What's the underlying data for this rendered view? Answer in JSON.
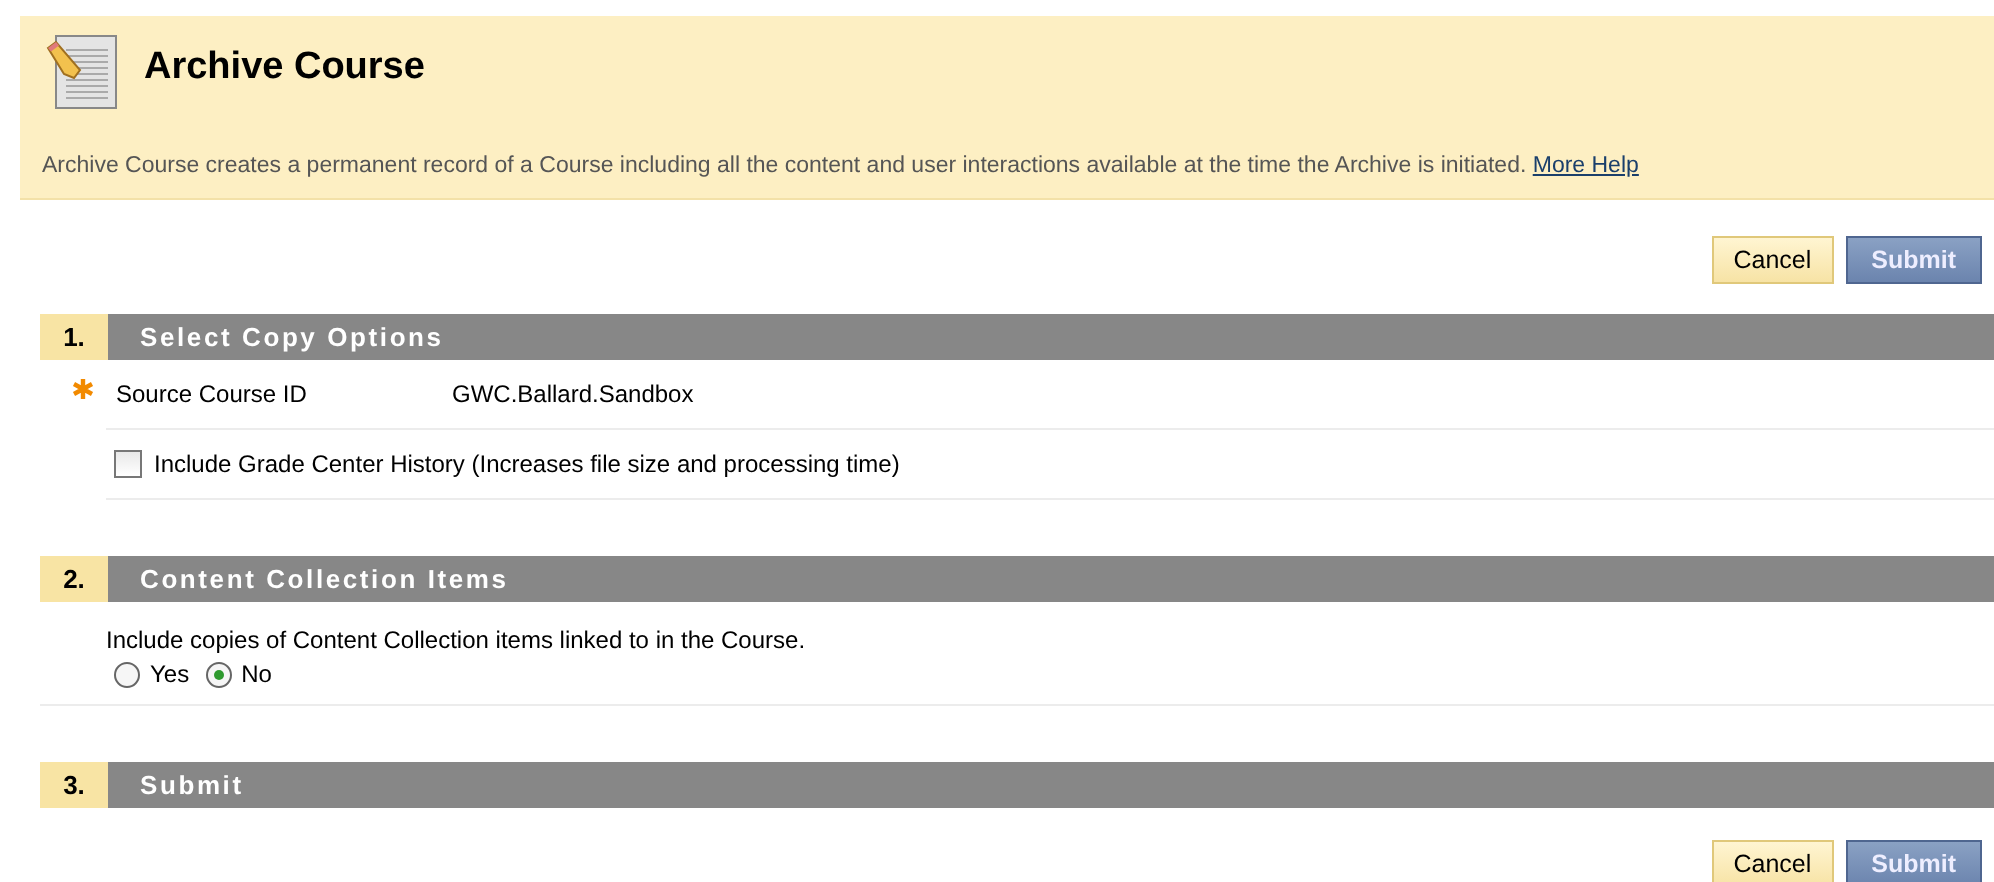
{
  "header": {
    "title": "Archive Course",
    "description": "Archive Course creates a permanent record of a Course including all the content and user interactions available at the time the Archive is initiated.",
    "help_link": "More Help"
  },
  "top_buttons": [
    {
      "label": "Cancel",
      "kind": "secondary"
    },
    {
      "label": "Submit",
      "kind": "primary"
    }
  ],
  "sections": [
    {
      "number": "1.",
      "title": "Select Copy Options",
      "rows": [
        {
          "kind": "field",
          "required": true,
          "label": "Source Course ID",
          "value": "GWC.Ballard.Sandbox"
        },
        {
          "kind": "checkbox",
          "checked": false,
          "label": "Include Grade Center History (Increases file size and processing time)"
        }
      ]
    },
    {
      "number": "2.",
      "title": "Content Collection Items",
      "rows": [
        {
          "kind": "radio",
          "prompt": "Include copies of Content Collection items linked to in the Course.",
          "options": [
            {
              "label": "Yes",
              "selected": false
            },
            {
              "label": "No",
              "selected": true
            }
          ]
        }
      ]
    },
    {
      "number": "3.",
      "title": "Submit"
    }
  ],
  "bottom_buttons": [
    {
      "label": "Cancel",
      "kind": "secondary"
    },
    {
      "label": "Submit",
      "kind": "primary"
    }
  ]
}
